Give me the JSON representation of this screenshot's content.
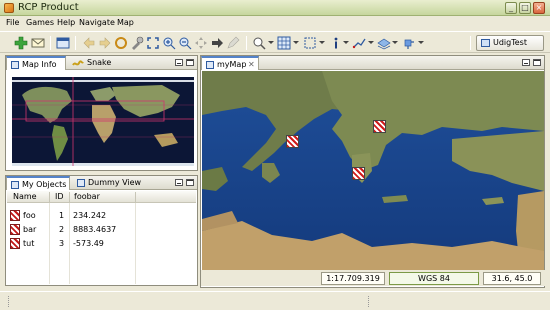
{
  "window": {
    "title": "RCP Product"
  },
  "menu": [
    "File",
    "Games",
    "Help",
    "Navigate",
    "Map"
  ],
  "perspective": {
    "label": "UdigTest"
  },
  "left_top": {
    "tabs": [
      "Map Info",
      "Snake"
    ]
  },
  "left_bottom": {
    "tabs": [
      "My Objects",
      "Dummy View"
    ],
    "columns": [
      "Name",
      "ID",
      "foobar"
    ],
    "rows": [
      {
        "name": "foo",
        "id": "1",
        "foobar": "234.242"
      },
      {
        "name": "bar",
        "id": "2",
        "foobar": "8883.4637"
      },
      {
        "name": "tut",
        "id": "3",
        "foobar": "-573.49"
      }
    ]
  },
  "editor": {
    "tab": "myMap"
  },
  "status": {
    "scale": "1:17.709.319",
    "crs": "WGS 84",
    "coords": "31.6, 45.0"
  },
  "colors": {
    "accent": "#5483c9",
    "hatch": "#c41a1a",
    "ocean": "#1f4f9a"
  }
}
